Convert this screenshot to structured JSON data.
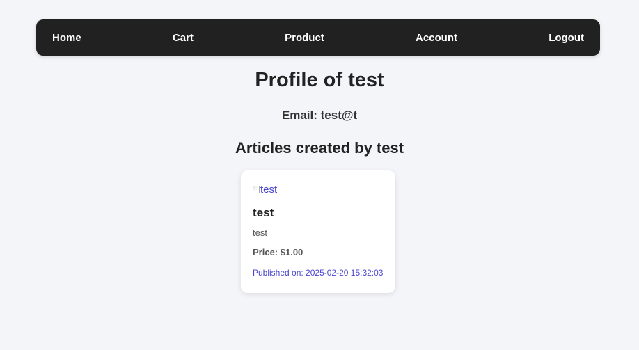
{
  "nav": {
    "home": "Home",
    "cart": "Cart",
    "product": "Product",
    "account": "Account",
    "logout": "Logout"
  },
  "profile": {
    "title": "Profile of test",
    "email": "Email: test@t",
    "articles_heading": "Articles created by test"
  },
  "article": {
    "image_alt": "test",
    "title": "test",
    "description": "test",
    "price": "Price: $1.00",
    "published": "Published on: 2025-02-20 15:32:03"
  },
  "colors": {
    "navbar_bg": "#212121",
    "page_bg": "#f4f5f9",
    "link_accent": "#4a47d1"
  }
}
